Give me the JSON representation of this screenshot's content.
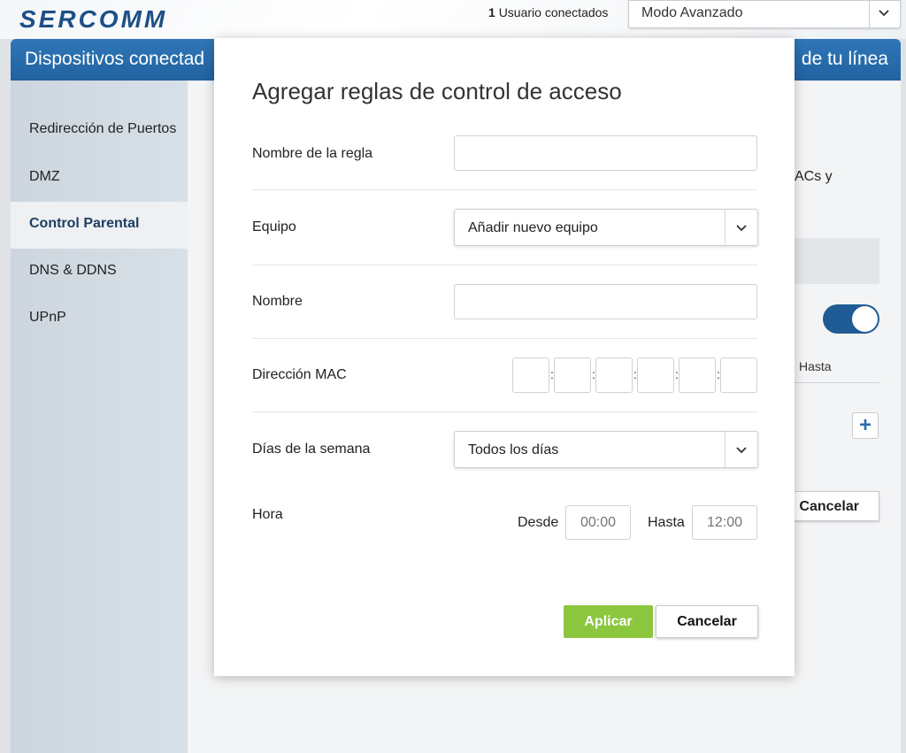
{
  "header": {
    "logo": "SERCOMM",
    "users_count": "1",
    "users_label": "Usuario conectados",
    "mode": "Modo Avanzado"
  },
  "navbar": {
    "left_title": "Dispositivos conectad",
    "right_title": "de tu línea"
  },
  "sidebar": {
    "items": [
      {
        "label": "Redirección de Puertos"
      },
      {
        "label": "DMZ"
      },
      {
        "label": "Control Parental"
      },
      {
        "label": "DNS & DDNS"
      },
      {
        "label": "UPnP"
      }
    ]
  },
  "background": {
    "partial_text": "ACs y",
    "col_hasta": "Hasta",
    "plus": "+",
    "cancel": "Cancelar"
  },
  "modal": {
    "title": "Agregar reglas de control de acceso",
    "rule_name_label": "Nombre de la regla",
    "rule_name_value": "",
    "device_label": "Equipo",
    "device_value": "Añadir nuevo equipo",
    "name_label": "Nombre",
    "name_value": "",
    "mac_label": "Dirección MAC",
    "mac_separator": ":",
    "mac_octets": [
      "",
      "",
      "",
      "",
      "",
      ""
    ],
    "days_label": "Días de la semana",
    "days_value": "Todos los días",
    "time_label": "Hora",
    "from_label": "Desde",
    "from_placeholder": "00:00",
    "to_label": "Hasta",
    "to_placeholder": "12:00",
    "apply_label": "Aplicar",
    "cancel_label": "Cancelar"
  },
  "colors": {
    "brand_blue": "#22629f",
    "apply_green": "#8cc63f"
  }
}
